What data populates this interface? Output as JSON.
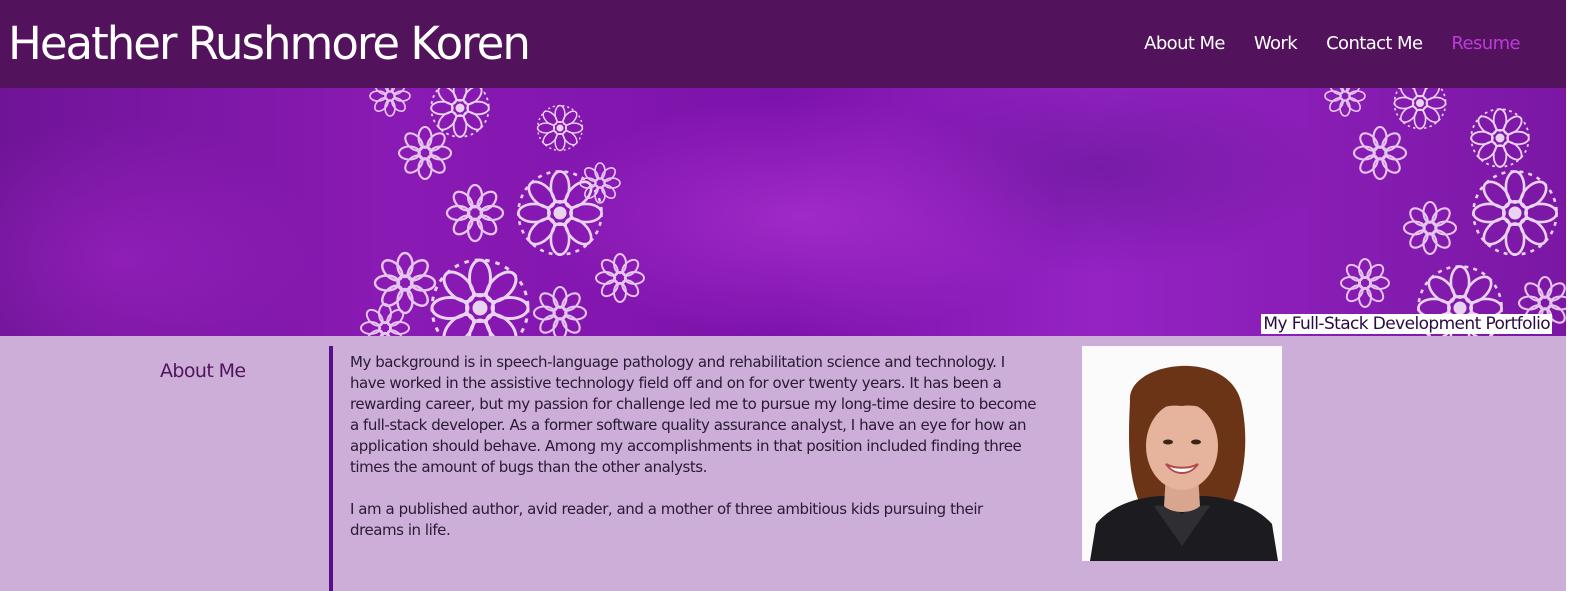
{
  "header": {
    "site_title": "Heather Rushmore Koren",
    "nav": [
      {
        "label": "About Me"
      },
      {
        "label": "Work"
      },
      {
        "label": "Contact Me"
      },
      {
        "label": "Resume"
      }
    ],
    "active_nav": "Resume"
  },
  "hero": {
    "caption": "My Full-Stack Development Portfolio"
  },
  "about": {
    "heading": "About Me",
    "paragraphs": [
      "My background is in speech-language pathology and rehabilitation science and technology. I have worked in the assistive technology field off and on for over twenty years. It has been a rewarding career, but my passion for challenge led me to pursue my long-time desire to become a full-stack developer. As a former software quality assurance analyst, I have an eye for how an application should behave. Among my accomplishments in that position included finding three times the amount of bugs than the other analysts.",
      "I am a published author, avid reader, and a mother of three ambitious kids pursuing their dreams in life."
    ]
  },
  "colors": {
    "header_bg": "#52135c",
    "page_bg": "#ccaed8",
    "active_link": "#ba3dd7",
    "divider": "#5b0e8a"
  }
}
